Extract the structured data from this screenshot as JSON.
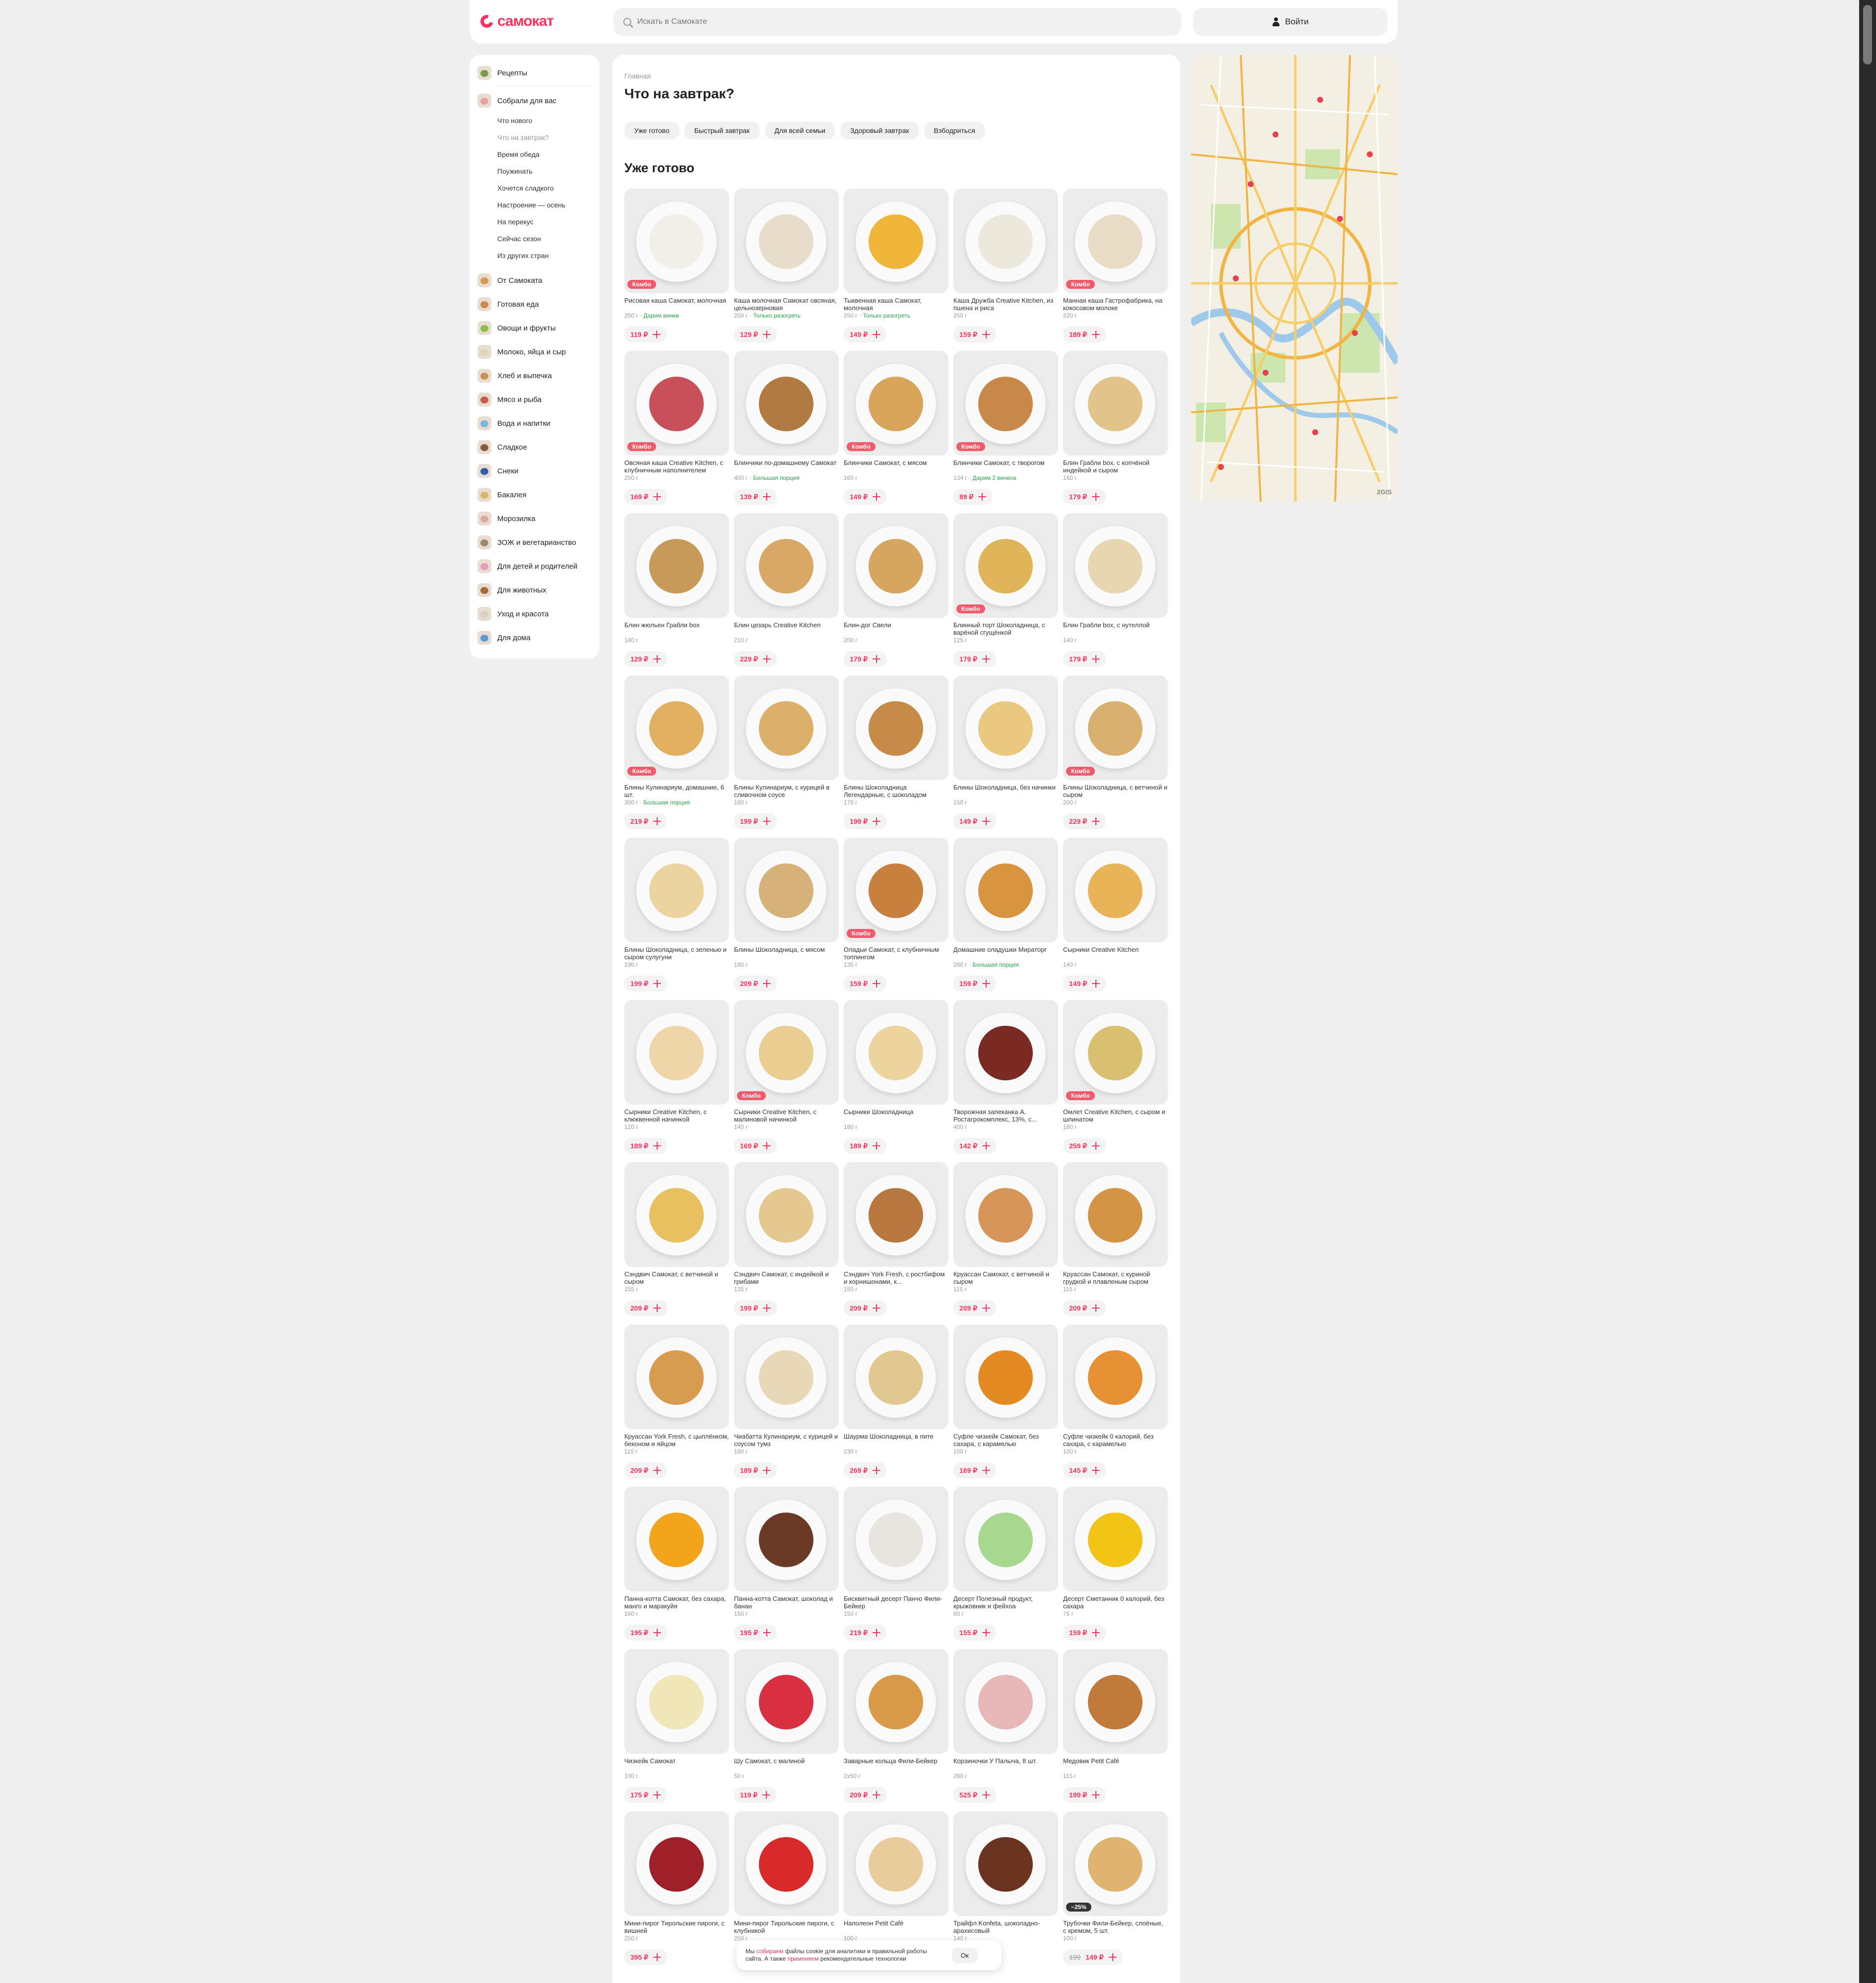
{
  "header": {
    "logo_text": "самокат",
    "search_placeholder": "Искать в Самокате",
    "login_label": "Войти"
  },
  "sidebar": {
    "categories": [
      {
        "label": "Рецепты",
        "color": "#7c9a4a"
      },
      {
        "label": "Собрали для вас",
        "color": "#e8a0a0"
      },
      {
        "label": "От Самоката",
        "color": "#d69a55"
      },
      {
        "label": "Готовая еда",
        "color": "#c88a50"
      },
      {
        "label": "Овощи и фрукты",
        "color": "#8bbf4a"
      },
      {
        "label": "Молоко, яйца и сыр",
        "color": "#dfd3b0"
      },
      {
        "label": "Хлеб и выпечка",
        "color": "#c9924e"
      },
      {
        "label": "Мясо и рыба",
        "color": "#c85a4a"
      },
      {
        "label": "Вода и напитки",
        "color": "#7ab8e0"
      },
      {
        "label": "Сладкое",
        "color": "#8a5a3a"
      },
      {
        "label": "Снеки",
        "color": "#2f5ea8"
      },
      {
        "label": "Бакалея",
        "color": "#d9b56a"
      },
      {
        "label": "Морозилка",
        "color": "#e0a8a0"
      },
      {
        "label": "ЗОЖ и вегетарианство",
        "color": "#9a8a6a"
      },
      {
        "label": "Для детей и родителей",
        "color": "#e4a0b8"
      },
      {
        "label": "Для животных",
        "color": "#a8683a"
      },
      {
        "label": "Уход и красота",
        "color": "#d8d0c8"
      },
      {
        "label": "Для дома",
        "color": "#5a9ad0"
      }
    ],
    "subitems": [
      {
        "label": "Что нового",
        "active": false
      },
      {
        "label": "Что на завтрак?",
        "active": true
      },
      {
        "label": "Время обеда",
        "active": false
      },
      {
        "label": "Поужинать",
        "active": false
      },
      {
        "label": "Хочется сладкого",
        "active": false
      },
      {
        "label": "Настроение — осень",
        "active": false
      },
      {
        "label": "На перекус",
        "active": false
      },
      {
        "label": "Сейчас сезон",
        "active": false
      },
      {
        "label": "Из других стран",
        "active": false
      }
    ]
  },
  "main": {
    "breadcrumb": "Главная",
    "title": "Что на завтрак?",
    "chips": [
      "Уже готово",
      "Быстрый завтрак",
      "Для всей семьи",
      "Здоровый завтрак",
      "Взбодриться"
    ],
    "section_title": "Уже готово",
    "products": [
      {
        "name": "Рисовая каша Самокат, молочная",
        "weight": "250 г",
        "tag": "Дарим винки",
        "price": "119 ₽",
        "badge": "Комбо",
        "food": "#f2efe8"
      },
      {
        "name": "Каша молочная Самокат овсяная, цельнозерновая",
        "weight": "250 г",
        "tag": "Только разогреть",
        "price": "129 ₽",
        "badge": "",
        "food": "#e8dccb"
      },
      {
        "name": "Тыквенная каша Самокат, молочная",
        "weight": "250 г",
        "tag": "Только разогреть",
        "price": "149 ₽",
        "badge": "",
        "food": "#f0b63a"
      },
      {
        "name": "Каша Дружба Creative Kitchen, из пшена и риса",
        "weight": "250 г",
        "tag": "",
        "price": "159 ₽",
        "badge": "",
        "food": "#ece9dc"
      },
      {
        "name": "Манная каша Гастрофабрика, на кокосовом молоке",
        "weight": "220 г",
        "tag": "",
        "price": "189 ₽",
        "badge": "Комбо",
        "food": "#e9dcc6"
      },
      {
        "name": "Овсяная каша Creative Kitchen, с клубничным наполнителем",
        "weight": "250 г",
        "tag": "",
        "price": "169 ₽",
        "badge": "Комбо",
        "food": "#c8505a"
      },
      {
        "name": "Блинчики по-домашнему Самокат",
        "weight": "400 г",
        "tag": "Большая порция",
        "price": "139 ₽",
        "badge": "",
        "food": "#b07a42"
      },
      {
        "name": "Блинчики Самокат, с мясом",
        "weight": "160 г",
        "tag": "",
        "price": "149 ₽",
        "badge": "Комбо",
        "food": "#d9a55a"
      },
      {
        "name": "Блинчики Самокат, с творогом",
        "weight": "134 г",
        "tag": "Дарим 2 винкоа",
        "price": "89 ₽",
        "badge": "Комбо",
        "food": "#c8884a"
      },
      {
        "name": "Блин Грабли box, с копчёной индейкой и сыром",
        "weight": "160 г",
        "tag": "",
        "price": "179 ₽",
        "badge": "",
        "food": "#e2c48a"
      },
      {
        "name": "Блин жюльен Грабли box",
        "weight": "140 г",
        "tag": "",
        "price": "129 ₽",
        "badge": "",
        "food": "#c89a5a"
      },
      {
        "name": "Блин цезарь Creative Kitchen",
        "weight": "210 г",
        "tag": "",
        "price": "229 ₽",
        "badge": "",
        "food": "#d9a866"
      },
      {
        "name": "Блин-дог Свели",
        "weight": "200 г",
        "tag": "",
        "price": "179 ₽",
        "badge": "",
        "food": "#d6a660"
      },
      {
        "name": "Блинный торт Шоколадница, с варёной сгущёнкой",
        "weight": "125 г",
        "tag": "",
        "price": "179 ₽",
        "badge": "Комбо",
        "food": "#e0b458"
      },
      {
        "name": "Блин Грабли box, с нутеллой",
        "weight": "140 г",
        "tag": "",
        "price": "179 ₽",
        "badge": "",
        "food": "#e8d6b0"
      },
      {
        "name": "Блины Кулинариум, домашние, 6 шт.",
        "weight": "300 г",
        "tag": "Большая порция",
        "price": "219 ₽",
        "badge": "Комбо",
        "food": "#e2b060"
      },
      {
        "name": "Блины Кулинариум, с курицей в сливочном соусе",
        "weight": "180 г",
        "tag": "",
        "price": "199 ₽",
        "badge": "",
        "food": "#dcb06a"
      },
      {
        "name": "Блины Шоколадница Легендарные, с шоколадом",
        "weight": "170 г",
        "tag": "",
        "price": "199 ₽",
        "badge": "",
        "food": "#c88a48"
      },
      {
        "name": "Блины Шоколадница, без начинки",
        "weight": "150 г",
        "tag": "",
        "price": "149 ₽",
        "badge": "",
        "food": "#ebc880"
      },
      {
        "name": "Блины Шоколадница, с ветчиной и сыром",
        "weight": "200 г",
        "tag": "",
        "price": "229 ₽",
        "badge": "Комбо",
        "food": "#d8b070"
      },
      {
        "name": "Блины Шоколадница, с зеленью и сыром сулугуни",
        "weight": "190 г",
        "tag": "",
        "price": "199 ₽",
        "badge": "",
        "food": "#ecd4a0"
      },
      {
        "name": "Блины Шоколадница, с мясом",
        "weight": "180 г",
        "tag": "",
        "price": "209 ₽",
        "badge": "",
        "food": "#d6b27a"
      },
      {
        "name": "Оладьи Самокат, с клубничным топпингом",
        "weight": "135 г",
        "tag": "",
        "price": "159 ₽",
        "badge": "Комбо",
        "food": "#c9803e"
      },
      {
        "name": "Домашние оладушки Мираторг",
        "weight": "260 г",
        "tag": "Большая порция",
        "price": "159 ₽",
        "badge": "",
        "food": "#d8943e"
      },
      {
        "name": "Сырники Creative Kitchen",
        "weight": "140 г",
        "tag": "",
        "price": "149 ₽",
        "badge": "",
        "food": "#e9b458"
      },
      {
        "name": "Сырники Creative Kitchen, с клюквенной начинкой",
        "weight": "120 г",
        "tag": "",
        "price": "189 ₽",
        "badge": "",
        "food": "#efd6a8"
      },
      {
        "name": "Сырники Creative Kitchen, с малиновой начинкой",
        "weight": "140 г",
        "tag": "",
        "price": "169 ₽",
        "badge": "Комбо",
        "food": "#eacd90"
      },
      {
        "name": "Сырники Шоколадница",
        "weight": "180 г",
        "tag": "",
        "price": "189 ₽",
        "badge": "",
        "food": "#edd39e"
      },
      {
        "name": "Творожная запеканка А. Ростагрокомплекс, 13%, с...",
        "weight": "400 г",
        "tag": "",
        "price": "142 ₽",
        "badge": "",
        "food": "#7a2a22"
      },
      {
        "name": "Омлет Creative Kitchen, с сыром и шпинатом",
        "weight": "180 г",
        "tag": "",
        "price": "259 ₽",
        "badge": "Комбо",
        "food": "#d8c070"
      },
      {
        "name": "Сэндвич Самокат, с ветчиной и сыром",
        "weight": "155 г",
        "tag": "",
        "price": "209 ₽",
        "badge": "",
        "food": "#e8c060"
      },
      {
        "name": "Сэндвич Самокат, с индейкой и грибами",
        "weight": "135 г",
        "tag": "",
        "price": "199 ₽",
        "badge": "",
        "food": "#e4c890"
      },
      {
        "name": "Сэндвич York Fresh, с ростбифом и корнишонами, к...",
        "weight": "150 г",
        "tag": "",
        "price": "209 ₽",
        "badge": "",
        "food": "#b8773e"
      },
      {
        "name": "Круассан Самокат, с ветчиной и сыром",
        "weight": "115 г",
        "tag": "",
        "price": "209 ₽",
        "badge": "",
        "food": "#d8955a"
      },
      {
        "name": "Круассан Самокат, с куриной грудкой и плавленым сыром",
        "weight": "115 г",
        "tag": "",
        "price": "209 ₽",
        "badge": "",
        "food": "#d49446"
      },
      {
        "name": "Круассан York Fresh, с цыплёнком, беконом и яйцом",
        "weight": "115 г",
        "tag": "",
        "price": "209 ₽",
        "badge": "",
        "food": "#d89c50"
      },
      {
        "name": "Чиабатта Кулинариум, с курицей и соусом тумз",
        "weight": "160 г",
        "tag": "",
        "price": "189 ₽",
        "badge": "",
        "food": "#e8d8b8"
      },
      {
        "name": "Шаурма Шоколадница, в пите",
        "weight": "230 г",
        "tag": "",
        "price": "269 ₽",
        "badge": "",
        "food": "#e0c890"
      },
      {
        "name": "Суфле чизкейк Самокат, без сахара, с карамелью",
        "weight": "100 г",
        "tag": "",
        "price": "169 ₽",
        "badge": "",
        "food": "#e38a22"
      },
      {
        "name": "Суфле чизкейк 0 калорий, без сахара, с карамелью",
        "weight": "100 г",
        "tag": "",
        "price": "145 ₽",
        "badge": "",
        "food": "#e69234"
      },
      {
        "name": "Панна-котта Самокат, без сахара, манго и маракуйя",
        "weight": "160 г",
        "tag": "",
        "price": "195 ₽",
        "badge": "",
        "food": "#f2a51a"
      },
      {
        "name": "Панна-котта Самокат, шоколад и банан",
        "weight": "150 г",
        "tag": "",
        "price": "195 ₽",
        "badge": "",
        "food": "#6a3a26"
      },
      {
        "name": "Бисквитный десерт Панчо Фили-Бейкер",
        "weight": "150 г",
        "tag": "",
        "price": "219 ₽",
        "badge": "",
        "food": "#e8e4e0"
      },
      {
        "name": "Десерт Полезный продукт, крыжовник и фейхоа",
        "weight": "80 г",
        "tag": "",
        "price": "155 ₽",
        "badge": "",
        "food": "#a8d890"
      },
      {
        "name": "Десерт Сметанник 0 калорий, без сахара",
        "weight": "75 г",
        "tag": "",
        "price": "159 ₽",
        "badge": "",
        "food": "#f2c416"
      },
      {
        "name": "Чизкейк Самокат",
        "weight": "100 г",
        "tag": "",
        "price": "175 ₽",
        "badge": "",
        "food": "#f1e6b8"
      },
      {
        "name": "Шу Самокат, с малиной",
        "weight": "50 г",
        "tag": "",
        "price": "119 ₽",
        "badge": "",
        "food": "#d83040"
      },
      {
        "name": "Заварные кольца Фили-Бейкер",
        "weight": "2х50 г",
        "tag": "",
        "price": "209 ₽",
        "badge": "",
        "food": "#d89a48"
      },
      {
        "name": "Корзиночки У Палыча, 8 шт.",
        "weight": "280 г",
        "tag": "",
        "price": "525 ₽",
        "badge": "",
        "food": "#e8b8b8"
      },
      {
        "name": "Медовик Petit Café",
        "weight": "115 г",
        "tag": "",
        "price": "199 ₽",
        "badge": "",
        "food": "#c07a3a"
      },
      {
        "name": "Мини-пирог Тирольские пироги, с вишней",
        "weight": "250 г",
        "tag": "",
        "price": "395 ₽",
        "badge": "",
        "food": "#a0202a"
      },
      {
        "name": "Мини-пирог Тирольские пироги, с клубникой",
        "weight": "250 г",
        "tag": "",
        "price": "",
        "badge": "",
        "food": "#d82a2a"
      },
      {
        "name": "Наполеон Petit Café",
        "weight": "100 г",
        "tag": "",
        "price": "",
        "badge": "",
        "food": "#e8cc9c"
      },
      {
        "name": "Трайфл Konfeta, шоколадно-арахисовый",
        "weight": "140 г",
        "tag": "",
        "price": "",
        "badge": "",
        "food": "#6a3420"
      },
      {
        "name": "Трубочки Фили-Бейкер, слоёные, с кремом, 5 шт.",
        "weight": "100 г",
        "tag": "",
        "price": "149 ₽",
        "old_price": "199",
        "badge": "−25%",
        "food": "#e0b470"
      }
    ]
  },
  "map": {
    "brand": "2GIS"
  },
  "cookie": {
    "text_1": "Мы ",
    "link_1": "собираем",
    "text_2": " файлы cookie для аналитики и правильной работы сайта. А также ",
    "link_2": "применяем",
    "text_3": " рекомендательные технологии",
    "ok_label": "Ок"
  }
}
